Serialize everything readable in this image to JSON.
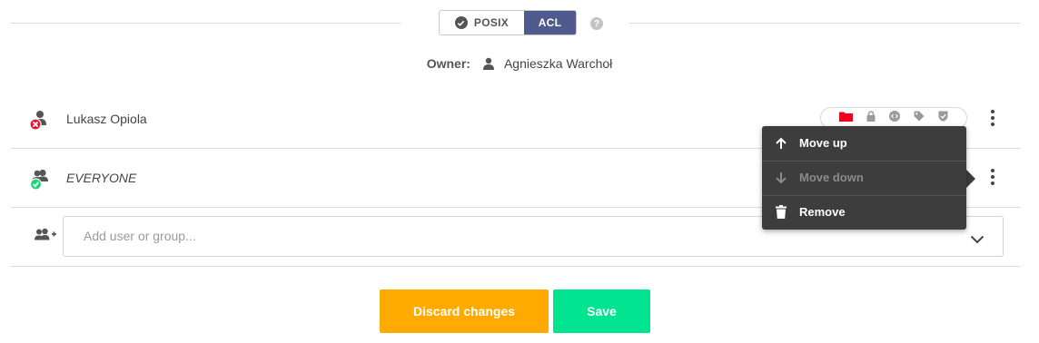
{
  "mode_toggle": {
    "posix_label": "POSIX",
    "acl_label": "ACL",
    "help_glyph": "?"
  },
  "owner": {
    "label": "Owner:",
    "name": "Agnieszka Warchoł"
  },
  "acl_entries": [
    {
      "name": "Lukasz Opiola",
      "type": "user",
      "status": "deny",
      "italic": false
    },
    {
      "name": "EVERYONE",
      "type": "group",
      "status": "allow",
      "italic": true
    }
  ],
  "permission_icons": [
    "folder-icon",
    "lock-icon",
    "code-icon",
    "tag-icon",
    "shield-check-icon"
  ],
  "add_field": {
    "placeholder": "Add user or group..."
  },
  "context_menu": {
    "items": [
      {
        "label": "Move up",
        "icon": "arrow-up-icon",
        "disabled": false
      },
      {
        "label": "Move down",
        "icon": "arrow-down-icon",
        "disabled": true
      },
      {
        "label": "Remove",
        "icon": "trash-icon",
        "disabled": false
      }
    ]
  },
  "actions": {
    "discard_label": "Discard changes",
    "save_label": "Save"
  },
  "colors": {
    "acl_active": "#4f5b8c",
    "discard": "#ffaa00",
    "save": "#00e48f",
    "deny": "#e0192e",
    "allow": "#1fd67a",
    "folder_active": "#f0001c",
    "menu_bg": "#3d3d3d"
  }
}
